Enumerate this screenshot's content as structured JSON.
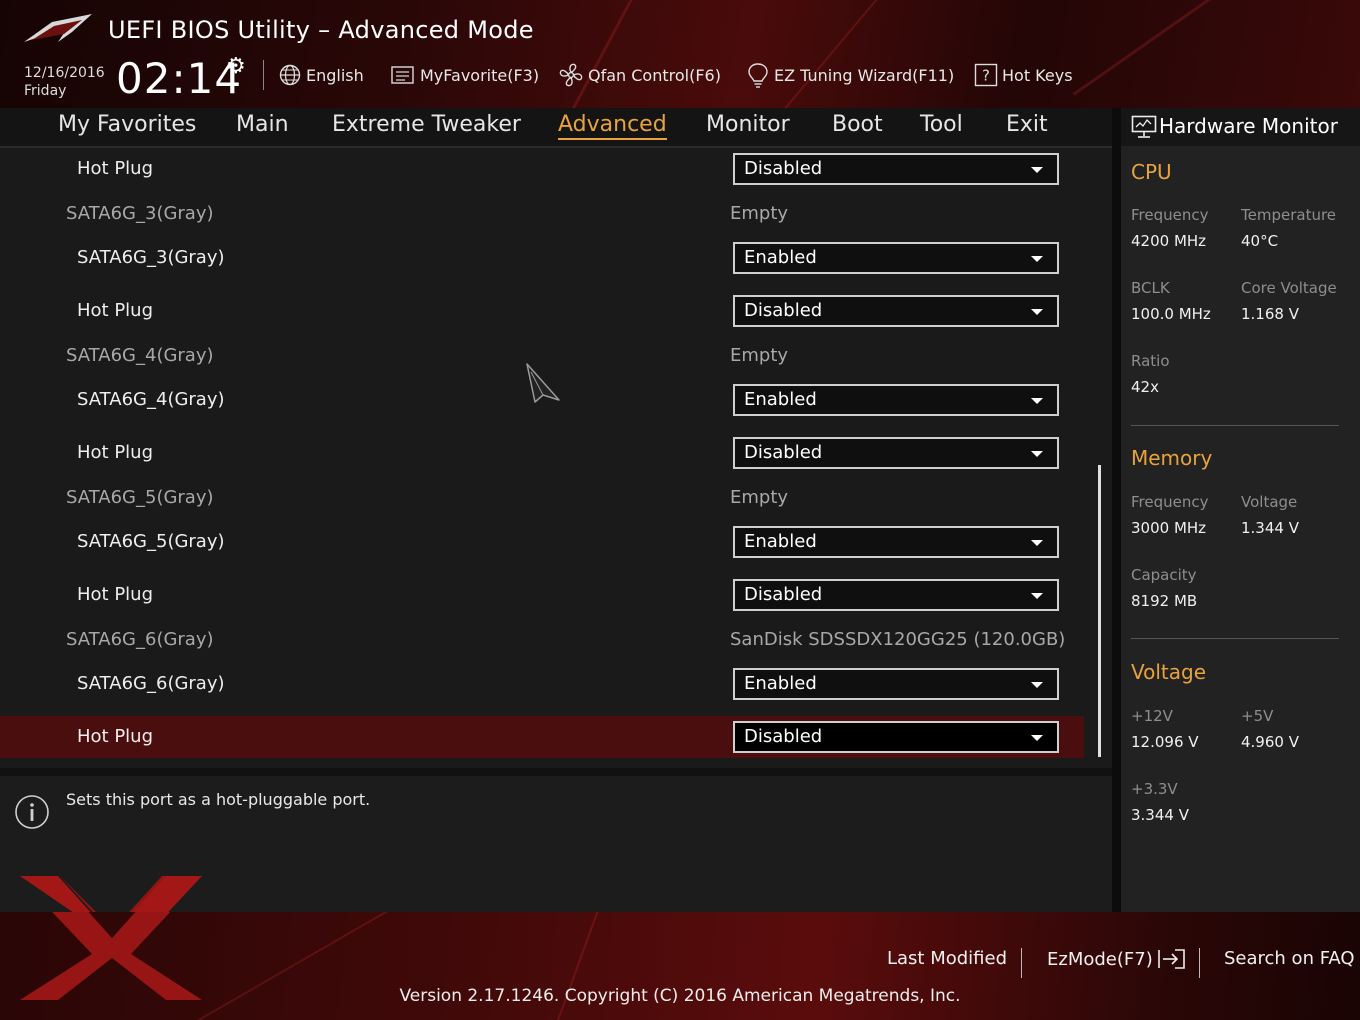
{
  "header": {
    "title": "UEFI BIOS Utility – Advanced Mode",
    "date": "12/16/2016",
    "day": "Friday",
    "time": "02:14",
    "buttons": {
      "language": "English",
      "favorite": "MyFavorite(F3)",
      "qfan": "Qfan Control(F6)",
      "ez_tuning": "EZ Tuning Wizard(F11)",
      "hot_keys": "Hot Keys"
    }
  },
  "nav": {
    "tabs": [
      "My Favorites",
      "Main",
      "Extreme Tweaker",
      "Advanced",
      "Monitor",
      "Boot",
      "Tool",
      "Exit"
    ],
    "active": "Advanced"
  },
  "settings": [
    {
      "type": "option",
      "label": "Hot Plug",
      "value": "Disabled"
    },
    {
      "type": "info",
      "label": "SATA6G_3(Gray)",
      "value": "Empty"
    },
    {
      "type": "option",
      "label": "SATA6G_3(Gray)",
      "value": "Enabled"
    },
    {
      "type": "option",
      "label": "Hot Plug",
      "value": "Disabled"
    },
    {
      "type": "info",
      "label": "SATA6G_4(Gray)",
      "value": "Empty"
    },
    {
      "type": "option",
      "label": "SATA6G_4(Gray)",
      "value": "Enabled"
    },
    {
      "type": "option",
      "label": "Hot Plug",
      "value": "Disabled"
    },
    {
      "type": "info",
      "label": "SATA6G_5(Gray)",
      "value": "Empty"
    },
    {
      "type": "option",
      "label": "SATA6G_5(Gray)",
      "value": "Enabled"
    },
    {
      "type": "option",
      "label": "Hot Plug",
      "value": "Disabled"
    },
    {
      "type": "info",
      "label": "SATA6G_6(Gray)",
      "value": "SanDisk SDSSDX120GG25 (120.0GB)"
    },
    {
      "type": "option",
      "label": "SATA6G_6(Gray)",
      "value": "Enabled"
    },
    {
      "type": "option",
      "label": "Hot Plug",
      "value": "Disabled",
      "selected": true
    }
  ],
  "help": {
    "text": "Sets this port as a hot-pluggable port."
  },
  "hardware_monitor": {
    "title": "Hardware Monitor",
    "cpu": {
      "heading": "CPU",
      "frequency_label": "Frequency",
      "frequency": "4200 MHz",
      "temperature_label": "Temperature",
      "temperature": "40°C",
      "bclk_label": "BCLK",
      "bclk": "100.0 MHz",
      "core_voltage_label": "Core Voltage",
      "core_voltage": "1.168 V",
      "ratio_label": "Ratio",
      "ratio": "42x"
    },
    "memory": {
      "heading": "Memory",
      "frequency_label": "Frequency",
      "frequency": "3000 MHz",
      "voltage_label": "Voltage",
      "voltage": "1.344 V",
      "capacity_label": "Capacity",
      "capacity": "8192 MB"
    },
    "voltage": {
      "heading": "Voltage",
      "v12_label": "+12V",
      "v12": "12.096 V",
      "v5_label": "+5V",
      "v5": "4.960 V",
      "v33_label": "+3.3V",
      "v33": "3.344 V"
    }
  },
  "footer": {
    "last_modified": "Last Modified",
    "ezmode": "EzMode(F7)",
    "search_faq": "Search on FAQ",
    "version": "Version 2.17.1246. Copyright (C) 2016 American Megatrends, Inc."
  },
  "colors": {
    "accent": "#e8a33d",
    "selected_row": "#4a0e0e",
    "header_red": "#4a0b0b"
  }
}
